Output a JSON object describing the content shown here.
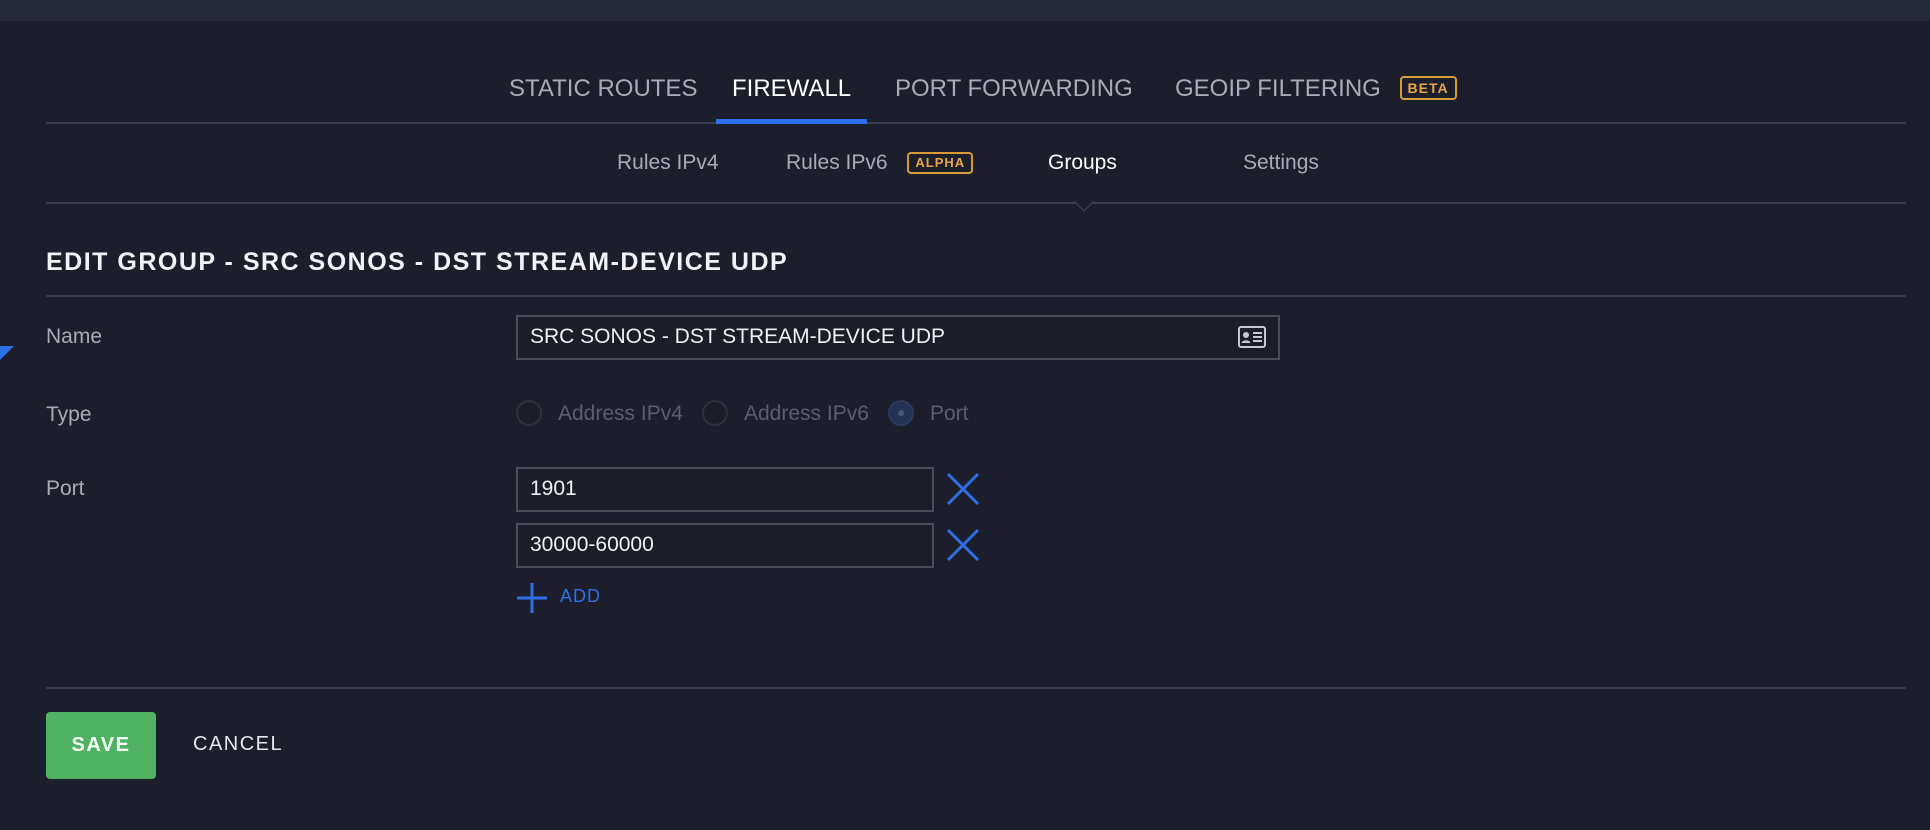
{
  "primary_tabs": [
    {
      "label": "STATIC ROUTES",
      "active": false
    },
    {
      "label": "FIREWALL",
      "active": true
    },
    {
      "label": "PORT FORWARDING",
      "active": false
    },
    {
      "label": "GEOIP FILTERING",
      "badge": "BETA",
      "active": false
    }
  ],
  "secondary_tabs": [
    {
      "label": "Rules IPv4",
      "active": false
    },
    {
      "label": "Rules IPv6",
      "badge": "ALPHA",
      "active": false
    },
    {
      "label": "Groups",
      "active": true
    },
    {
      "label": "Settings",
      "active": false
    }
  ],
  "form": {
    "title": "EDIT GROUP - SRC SONOS - DST STREAM-DEVICE UDP",
    "name_label": "Name",
    "name_value": "SRC SONOS - DST STREAM-DEVICE UDP",
    "type_label": "Type",
    "type_options": [
      {
        "label": "Address IPv4",
        "checked": false
      },
      {
        "label": "Address IPv6",
        "checked": false
      },
      {
        "label": "Port",
        "checked": true
      }
    ],
    "port_label": "Port",
    "ports": [
      "1901",
      "30000-60000"
    ],
    "add_label": "ADD"
  },
  "footer": {
    "save_label": "SAVE",
    "cancel_label": "CANCEL"
  },
  "colors": {
    "background": "#1c1e2b",
    "accent": "#2f6fe8",
    "badge": "#d99a36",
    "save": "#4fb262"
  },
  "icons": {
    "name_field": "contact-card-icon",
    "remove": "close-icon",
    "add": "plus-icon"
  }
}
